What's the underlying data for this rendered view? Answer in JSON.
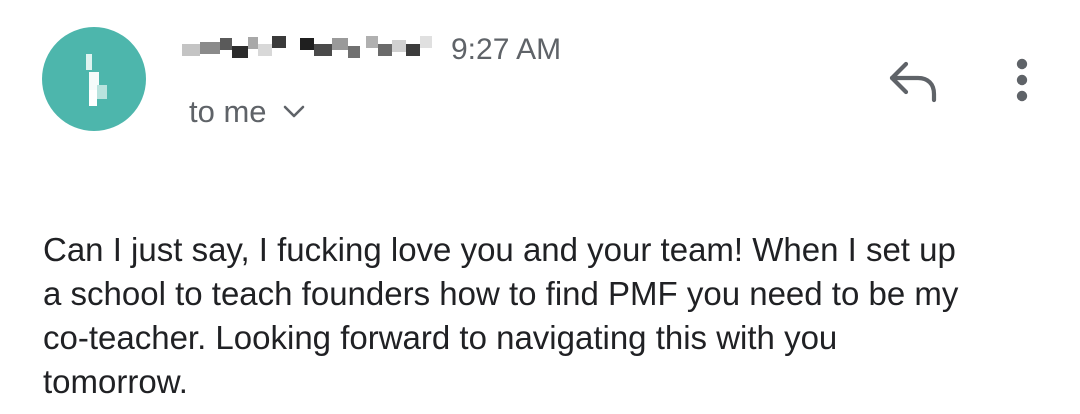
{
  "message": {
    "time": "9:27 AM",
    "recipients_label": "to me",
    "body_lines": [
      "Can I just say, I fucking love you and your team!  When I set up",
      "a school to teach founders how to find PMF you need to be my",
      "co-teacher.  Looking forward to navigating this with you",
      "tomorrow."
    ]
  },
  "icons": {
    "expand": "chevron-down-icon",
    "reply": "reply-icon",
    "more": "more-vertical-icon"
  },
  "colors": {
    "avatar_background": "#4db6ac",
    "secondary_text": "#5f6368",
    "body_text": "#202124"
  }
}
